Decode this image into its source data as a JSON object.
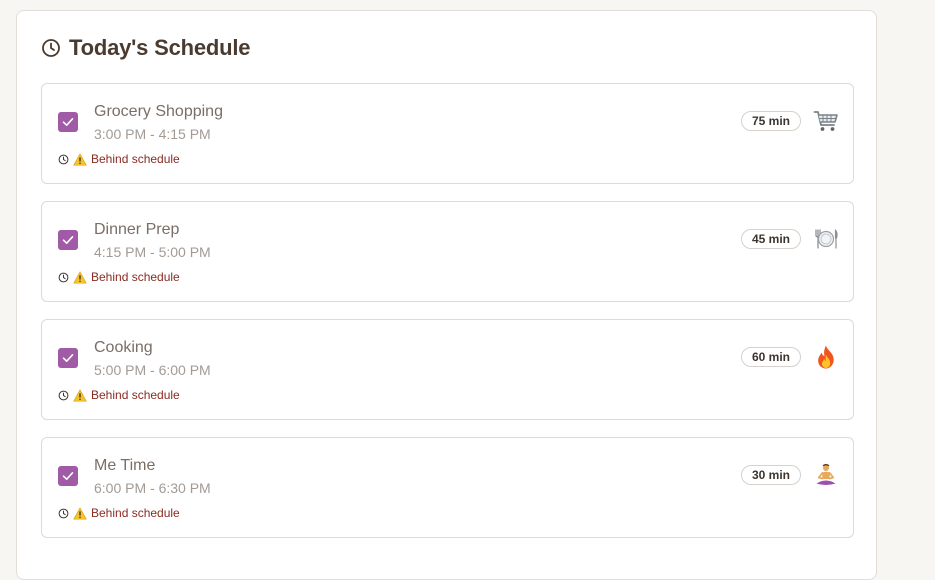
{
  "schedule": {
    "title": "Today's Schedule",
    "tasks": [
      {
        "title": "Grocery Shopping",
        "time": "3:00 PM - 4:15 PM",
        "duration": "75 min",
        "status": "Behind schedule",
        "icon": "shopping-cart-icon",
        "completed": true
      },
      {
        "title": "Dinner Prep",
        "time": "4:15 PM - 5:00 PM",
        "duration": "45 min",
        "status": "Behind schedule",
        "icon": "plate-cutlery-icon",
        "completed": true
      },
      {
        "title": "Cooking",
        "time": "5:00 PM - 6:00 PM",
        "duration": "60 min",
        "status": "Behind schedule",
        "icon": "fire-icon",
        "completed": true
      },
      {
        "title": "Me Time",
        "time": "6:00 PM - 6:30 PM",
        "duration": "30 min",
        "status": "Behind schedule",
        "icon": "meditation-icon",
        "completed": true
      }
    ]
  },
  "colors": {
    "checkbox": "#a05aa6",
    "title": "#4a3b30",
    "status": "#8a2b22"
  }
}
